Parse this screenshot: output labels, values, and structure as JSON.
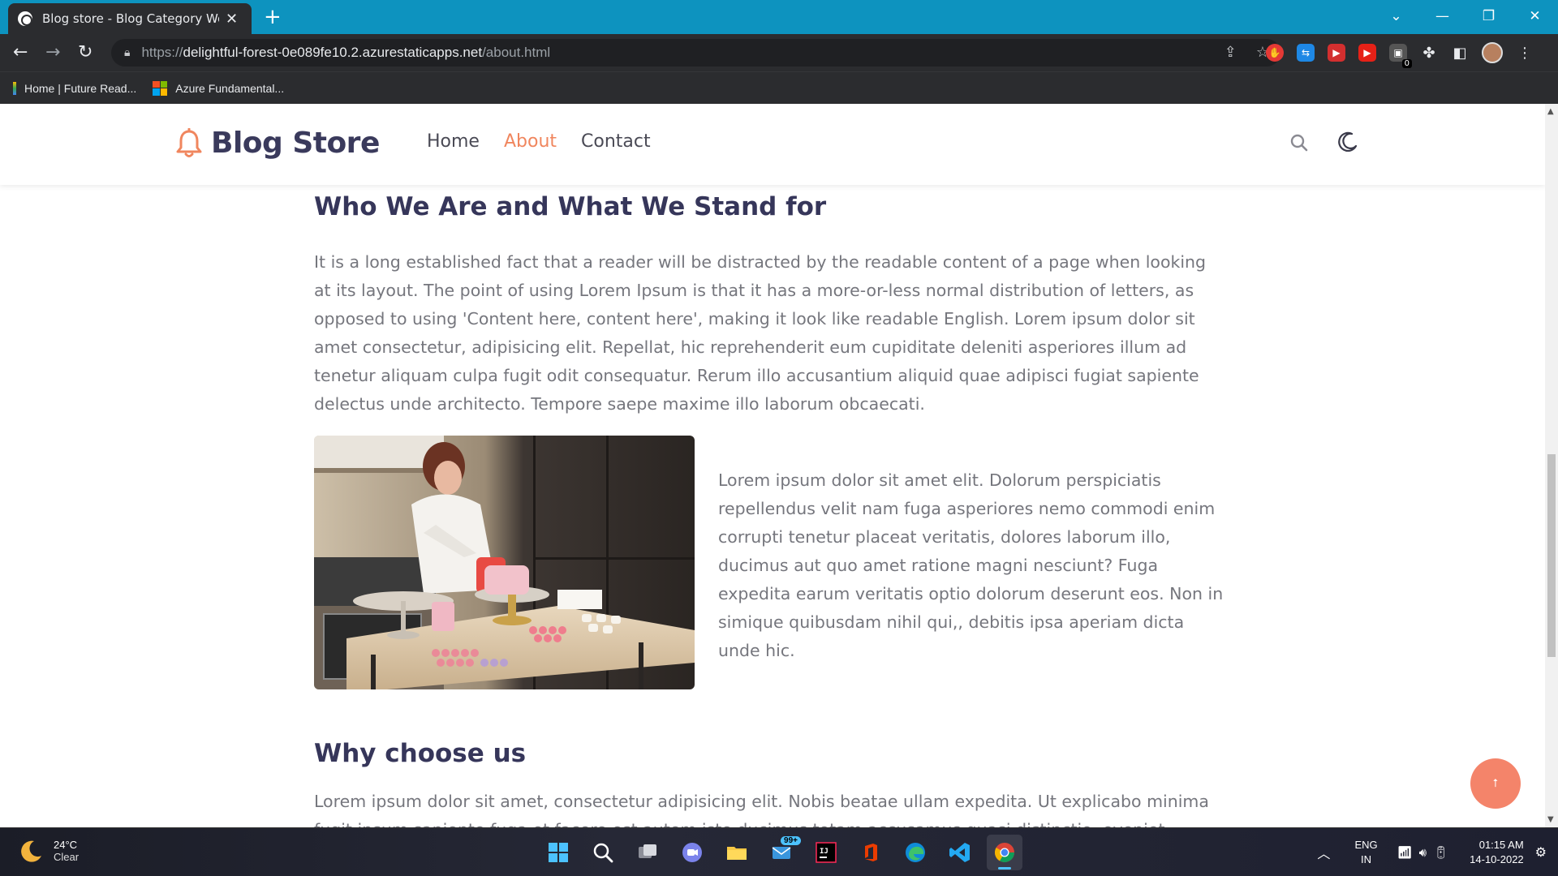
{
  "browser": {
    "tab_title": "Blog store - Blog Category Webs",
    "url_scheme": "https://",
    "url_host": "delightful-forest-0e089fe10.2.azurestaticapps.net",
    "url_path": "/about.html",
    "bookmarks": [
      {
        "label": "Home | Future Read..."
      },
      {
        "label": "Azure Fundamental..."
      }
    ],
    "extension_badge": "0"
  },
  "site": {
    "brand": "Blog Store",
    "nav": [
      {
        "label": "Home",
        "active": false
      },
      {
        "label": "About",
        "active": true
      },
      {
        "label": "Contact",
        "active": false
      }
    ],
    "accent_color": "#f0865e"
  },
  "about": {
    "heading": "Who We Are and What We Stand for",
    "intro": "It is a long established fact that a reader will be distracted by the readable content of a page when looking at its layout. The point of using Lorem Ipsum is that it has a more-or-less normal distribution of letters, as opposed to using 'Content here, content here', making it look like readable English. Lorem ipsum dolor sit amet consectetur, adipisicing elit. Repellat, hic reprehenderit eum cupiditate deleniti asperiores illum ad tenetur aliquam culpa fugit odit consequatur. Rerum illo accusantium aliquid quae adipisci fugiat sapiente delectus unde architecto. Tempore saepe maxime illo laborum obcaecati.",
    "side_text": "Lorem ipsum dolor sit amet elit. Dolorum perspiciatis repellendus velit nam fuga asperiores nemo commodi enim corrupti tenetur placeat veritatis, dolores laborum illo, ducimus aut quo amet ratione magni nesciunt? Fuga expedita earum veritatis optio dolorum deserunt eos. Non in simique quibusdam nihil qui,, debitis ipsa aperiam dicta unde hic.",
    "why_heading": "Why choose us",
    "why_text": "Lorem ipsum dolor sit amet, consectetur adipisicing elit. Nobis beatae ullam expedita. Ut explicabo minima fugit ipsum sapiente fuga et facere est autem iste ducimus totam accusamus quasi distinctio, eveniet voluptatum"
  },
  "taskbar": {
    "temperature": "24°C",
    "condition": "Clear",
    "mail_badge": "99+",
    "lang_top": "ENG",
    "lang_bottom": "IN",
    "time": "01:15 AM",
    "date": "14-10-2022"
  }
}
